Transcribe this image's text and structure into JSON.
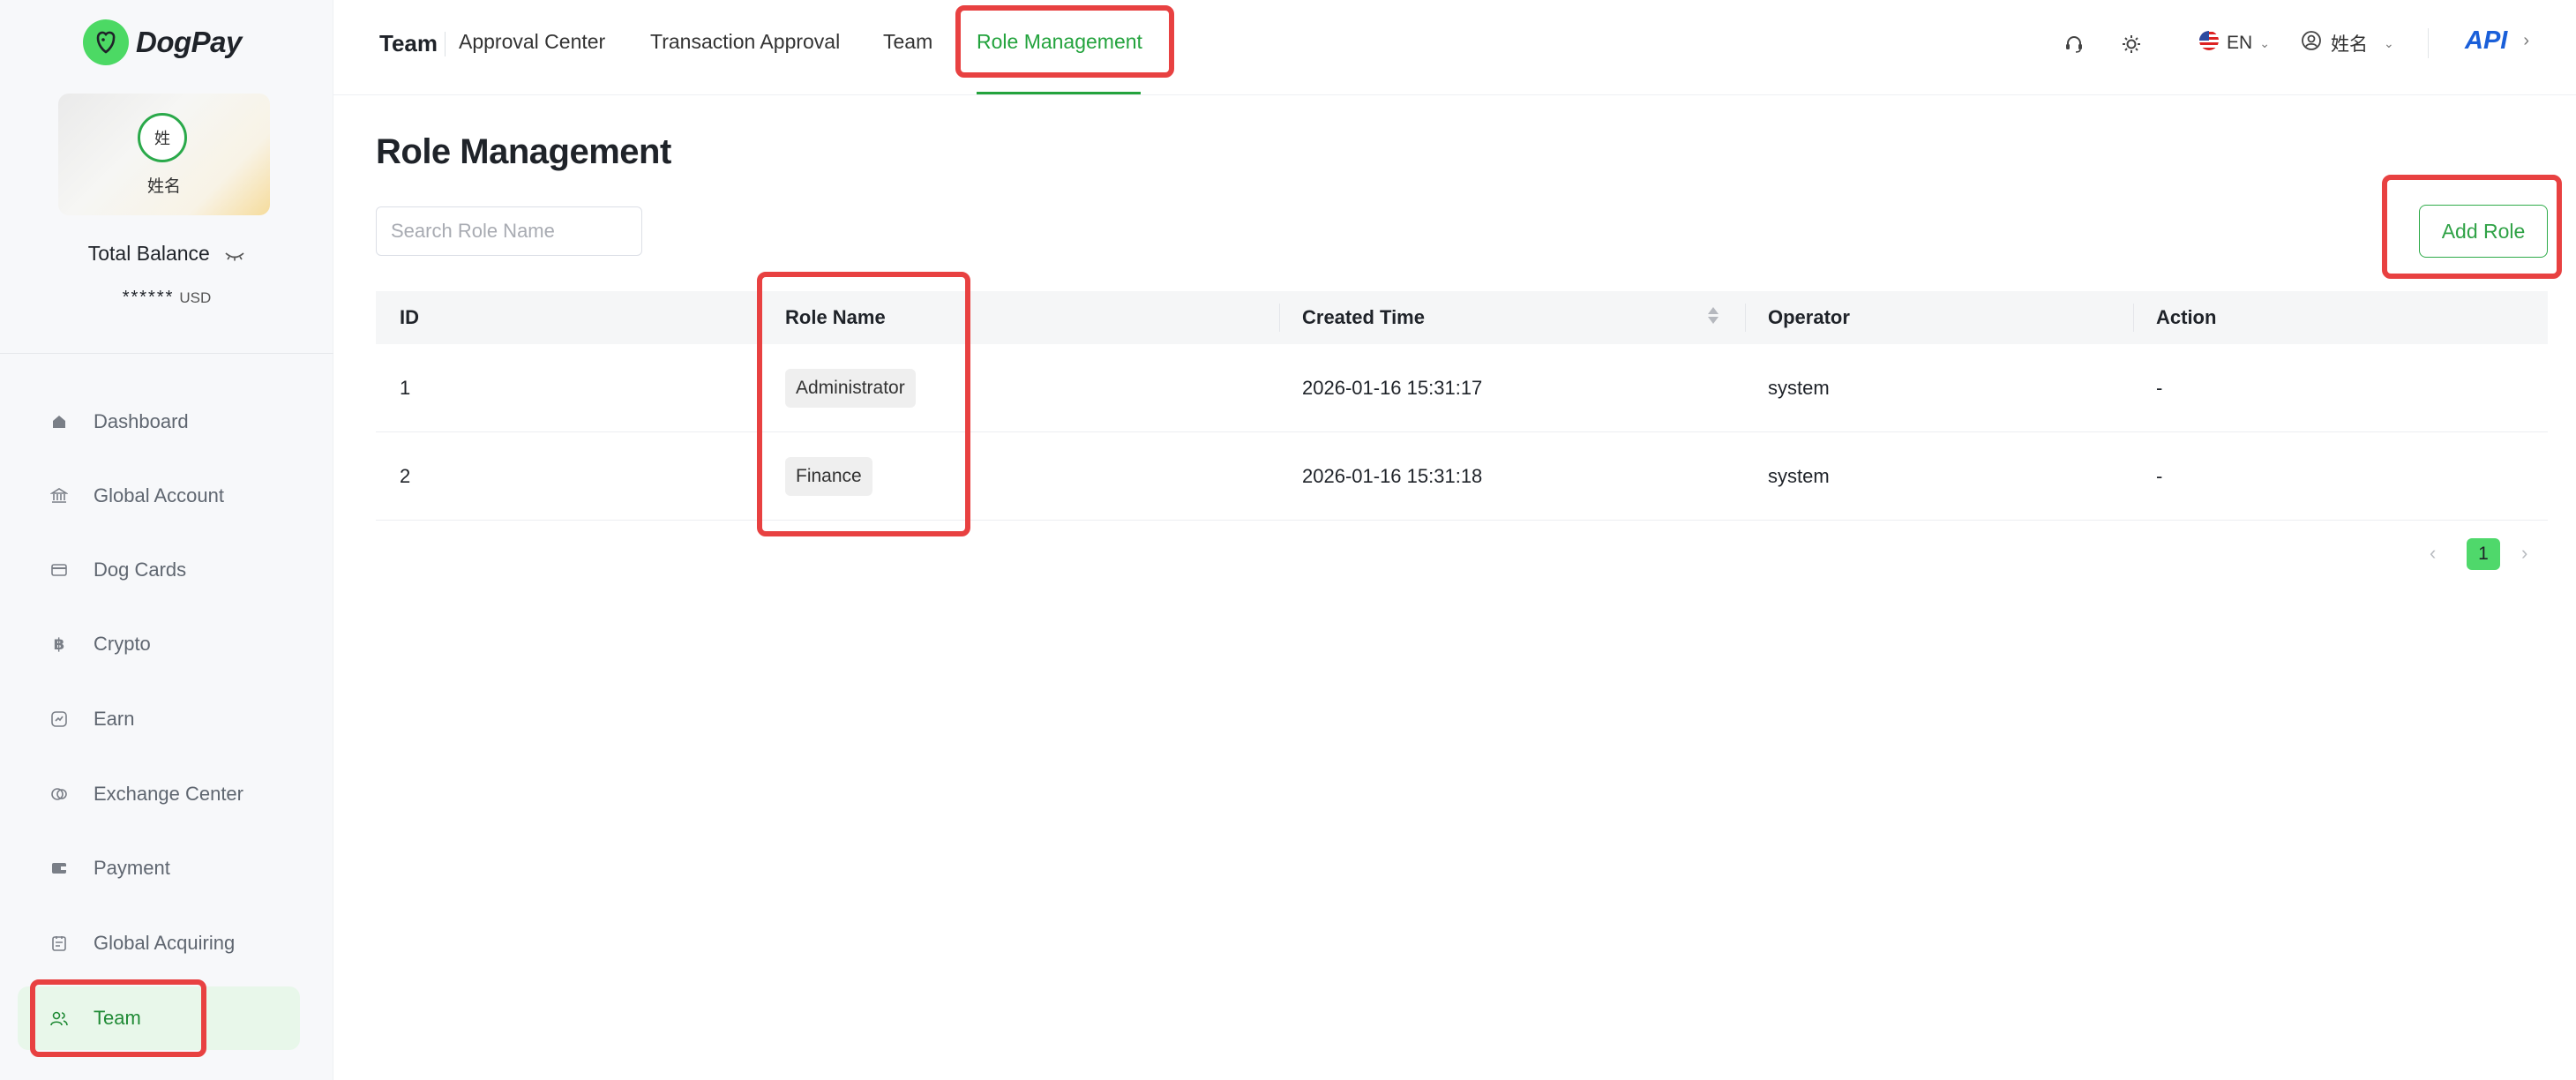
{
  "brand": {
    "name": "DogPay"
  },
  "profile": {
    "avatar_text": "姓",
    "name": "姓名"
  },
  "balance": {
    "label": "Total Balance",
    "masked_value": "******",
    "currency": "USD"
  },
  "sidebar": {
    "items": [
      {
        "label": "Dashboard",
        "icon": "home-icon"
      },
      {
        "label": "Global Account",
        "icon": "bank-icon"
      },
      {
        "label": "Dog Cards",
        "icon": "card-icon"
      },
      {
        "label": "Crypto",
        "icon": "bitcoin-icon"
      },
      {
        "label": "Earn",
        "icon": "earn-icon"
      },
      {
        "label": "Exchange Center",
        "icon": "exchange-icon"
      },
      {
        "label": "Payment",
        "icon": "wallet-icon"
      },
      {
        "label": "Global Acquiring",
        "icon": "acquiring-icon"
      },
      {
        "label": "Team",
        "icon": "team-icon",
        "active": true
      }
    ]
  },
  "header": {
    "root": "Team",
    "tabs": [
      {
        "label": "Approval Center"
      },
      {
        "label": "Transaction Approval"
      },
      {
        "label": "Team"
      },
      {
        "label": "Role Management",
        "active": true
      }
    ],
    "language": "EN",
    "user_name": "姓名",
    "api_label": "API"
  },
  "main": {
    "title": "Role Management",
    "search_placeholder": "Search Role Name",
    "add_button": "Add Role",
    "columns": [
      "ID",
      "Role Name",
      "Created Time",
      "Operator",
      "Action"
    ],
    "rows": [
      {
        "id": "1",
        "role": "Administrator",
        "created": "2026-01-16 15:31:17",
        "operator": "system",
        "action": "-"
      },
      {
        "id": "2",
        "role": "Finance",
        "created": "2026-01-16 15:31:18",
        "operator": "system",
        "action": "-"
      }
    ],
    "pagination": {
      "current_page": "1",
      "prev": "‹",
      "next": "›"
    }
  },
  "colors": {
    "accent": "#23a33d",
    "highlight": "#e84141",
    "api": "#1a5fd9"
  }
}
